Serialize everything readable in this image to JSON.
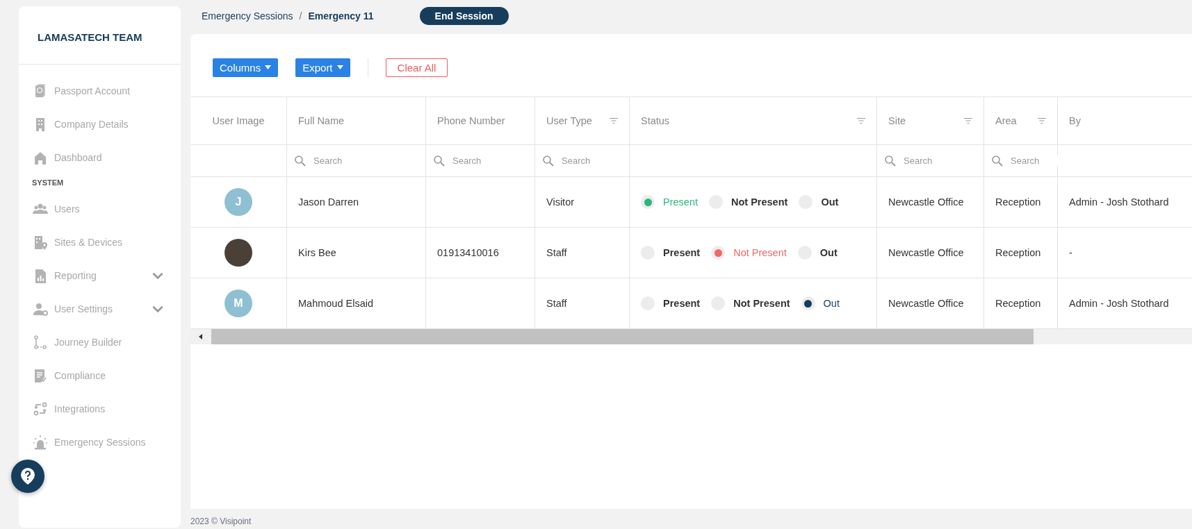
{
  "sidebar": {
    "title": "LAMASATECH TEAM",
    "groups": [
      {
        "items": [
          {
            "label": "Passport Account",
            "expandable": false
          },
          {
            "label": "Company Details",
            "expandable": false
          },
          {
            "label": "Dashboard",
            "expandable": false
          }
        ]
      },
      {
        "heading": "SYSTEM",
        "items": [
          {
            "label": "Users",
            "expandable": false
          },
          {
            "label": "Sites & Devices",
            "expandable": false
          },
          {
            "label": "Reporting",
            "expandable": true
          },
          {
            "label": "User Settings",
            "expandable": true
          },
          {
            "label": "Journey Builder",
            "expandable": false
          },
          {
            "label": "Compliance",
            "expandable": false
          },
          {
            "label": "Integrations",
            "expandable": false
          },
          {
            "label": "Emergency Sessions",
            "expandable": false
          }
        ]
      }
    ]
  },
  "breadcrumb": {
    "separator": "/",
    "items": [
      {
        "label": "Emergency Sessions",
        "current": false
      },
      {
        "label": "Emergency 11",
        "current": true
      }
    ]
  },
  "end_session_button": "End Session",
  "toolbar": {
    "buttons": [
      {
        "label": "Columns",
        "kind": "dropdown"
      },
      {
        "label": "Export",
        "kind": "dropdown"
      },
      {
        "label": "Clear All",
        "kind": "outline"
      }
    ]
  },
  "table": {
    "columns": [
      {
        "label": "User Image",
        "filter": false
      },
      {
        "label": "Full Name",
        "filter": false,
        "placeholder": "Search"
      },
      {
        "label": "Phone Number",
        "filter": false,
        "placeholder": "Search"
      },
      {
        "label": "User Type",
        "filter": true,
        "placeholder": "Search"
      },
      {
        "label": "Status",
        "filter": true
      },
      {
        "label": "Site",
        "filter": true,
        "placeholder": "Search"
      },
      {
        "label": "Area",
        "filter": true,
        "placeholder": "Search"
      },
      {
        "label": "By",
        "filter": false
      }
    ],
    "rows": [
      {
        "avatar": {
          "kind": "initial",
          "text": "J"
        },
        "full_name": "Jason Darren",
        "user_type": "Visitor",
        "status": [
          {
            "label": "Present",
            "kind": "present",
            "selected": true
          },
          {
            "label": "Not Present",
            "kind": "absent",
            "selected": false
          },
          {
            "label": "Out",
            "kind": "out",
            "selected": false
          }
        ],
        "site": "Newcastle Office",
        "area": "Reception",
        "by": "Admin - Josh Stothard"
      },
      {
        "avatar": {
          "kind": "photo"
        },
        "full_name": "Kirs Bee",
        "phone": "01913410016",
        "user_type": "Staff",
        "status": [
          {
            "label": "Present",
            "kind": "present",
            "selected": false
          },
          {
            "label": "Not Present",
            "kind": "absent",
            "selected": true
          },
          {
            "label": "Out",
            "kind": "out",
            "selected": false
          }
        ],
        "site": "Newcastle Office",
        "area": "Reception",
        "by": "-"
      },
      {
        "avatar": {
          "kind": "initial",
          "text": "M"
        },
        "full_name": "Mahmoud Elsaid",
        "user_type": "Staff",
        "status": [
          {
            "label": "Present",
            "kind": "present",
            "selected": false
          },
          {
            "label": "Not Present",
            "kind": "absent",
            "selected": false
          },
          {
            "label": "Out",
            "kind": "out",
            "selected": true
          }
        ],
        "site": "Newcastle Office",
        "area": "Reception",
        "by": "Admin - Josh Stothard"
      }
    ]
  },
  "footer": "2023 © Visipoint"
}
